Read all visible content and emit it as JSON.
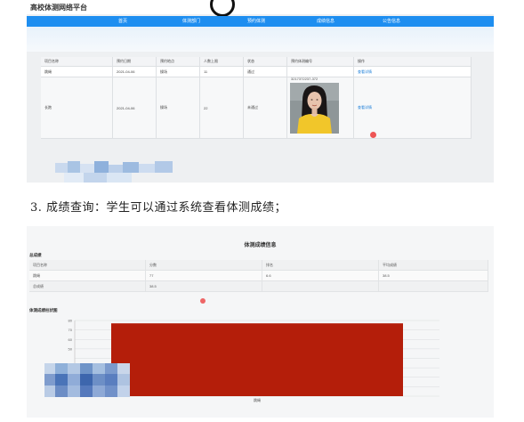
{
  "top_screenshot": {
    "site_title": "高校体测网络平台",
    "logo_text": "",
    "nav": [
      "首页",
      "体测部门",
      "预约体测",
      "成绩信息",
      "公告信息"
    ],
    "table": {
      "headers": [
        "项目名称",
        "预约日期",
        "预约地点",
        "人数上限",
        "状态",
        "预约体测编号",
        "操作"
      ],
      "rows": [
        {
          "name": "跳绳",
          "date": "2021-04-06",
          "place": "操场",
          "limit": "11",
          "status": "通过",
          "photo": false,
          "action": "查看详情"
        },
        {
          "name": "长跑",
          "date": "2021-04-06",
          "place": "操场",
          "limit": "22",
          "status": "未通过",
          "photo": true,
          "photo_label": "3217372237-372",
          "action": "查看详情"
        }
      ]
    }
  },
  "caption": "3. 成绩查询：学生可以通过系统查看体测成绩；",
  "bottom_screenshot": {
    "title": "体测成绩信息",
    "subtitle": "总成绩",
    "table": [
      [
        "项目名称",
        "分数",
        "排名",
        "平均成绩"
      ],
      [
        "跳绳",
        "77",
        "6.6",
        "38.5"
      ],
      [
        "总成绩",
        "38.5",
        "",
        ""
      ]
    ],
    "chart_title": "体测成绩柱状图"
  },
  "chart_data": {
    "type": "bar",
    "categories": [
      "跳绳"
    ],
    "values": [
      77
    ],
    "ylim": [
      0,
      80
    ],
    "yticks": [
      0,
      10,
      20,
      30,
      40,
      50,
      60,
      70,
      80
    ],
    "ytick_labels": [
      "",
      "",
      "",
      "",
      "",
      "50",
      "60",
      "70",
      "80"
    ],
    "bar_color": "#b41e0a",
    "grid": true,
    "xlabel": "",
    "ylabel": "",
    "title": ""
  }
}
